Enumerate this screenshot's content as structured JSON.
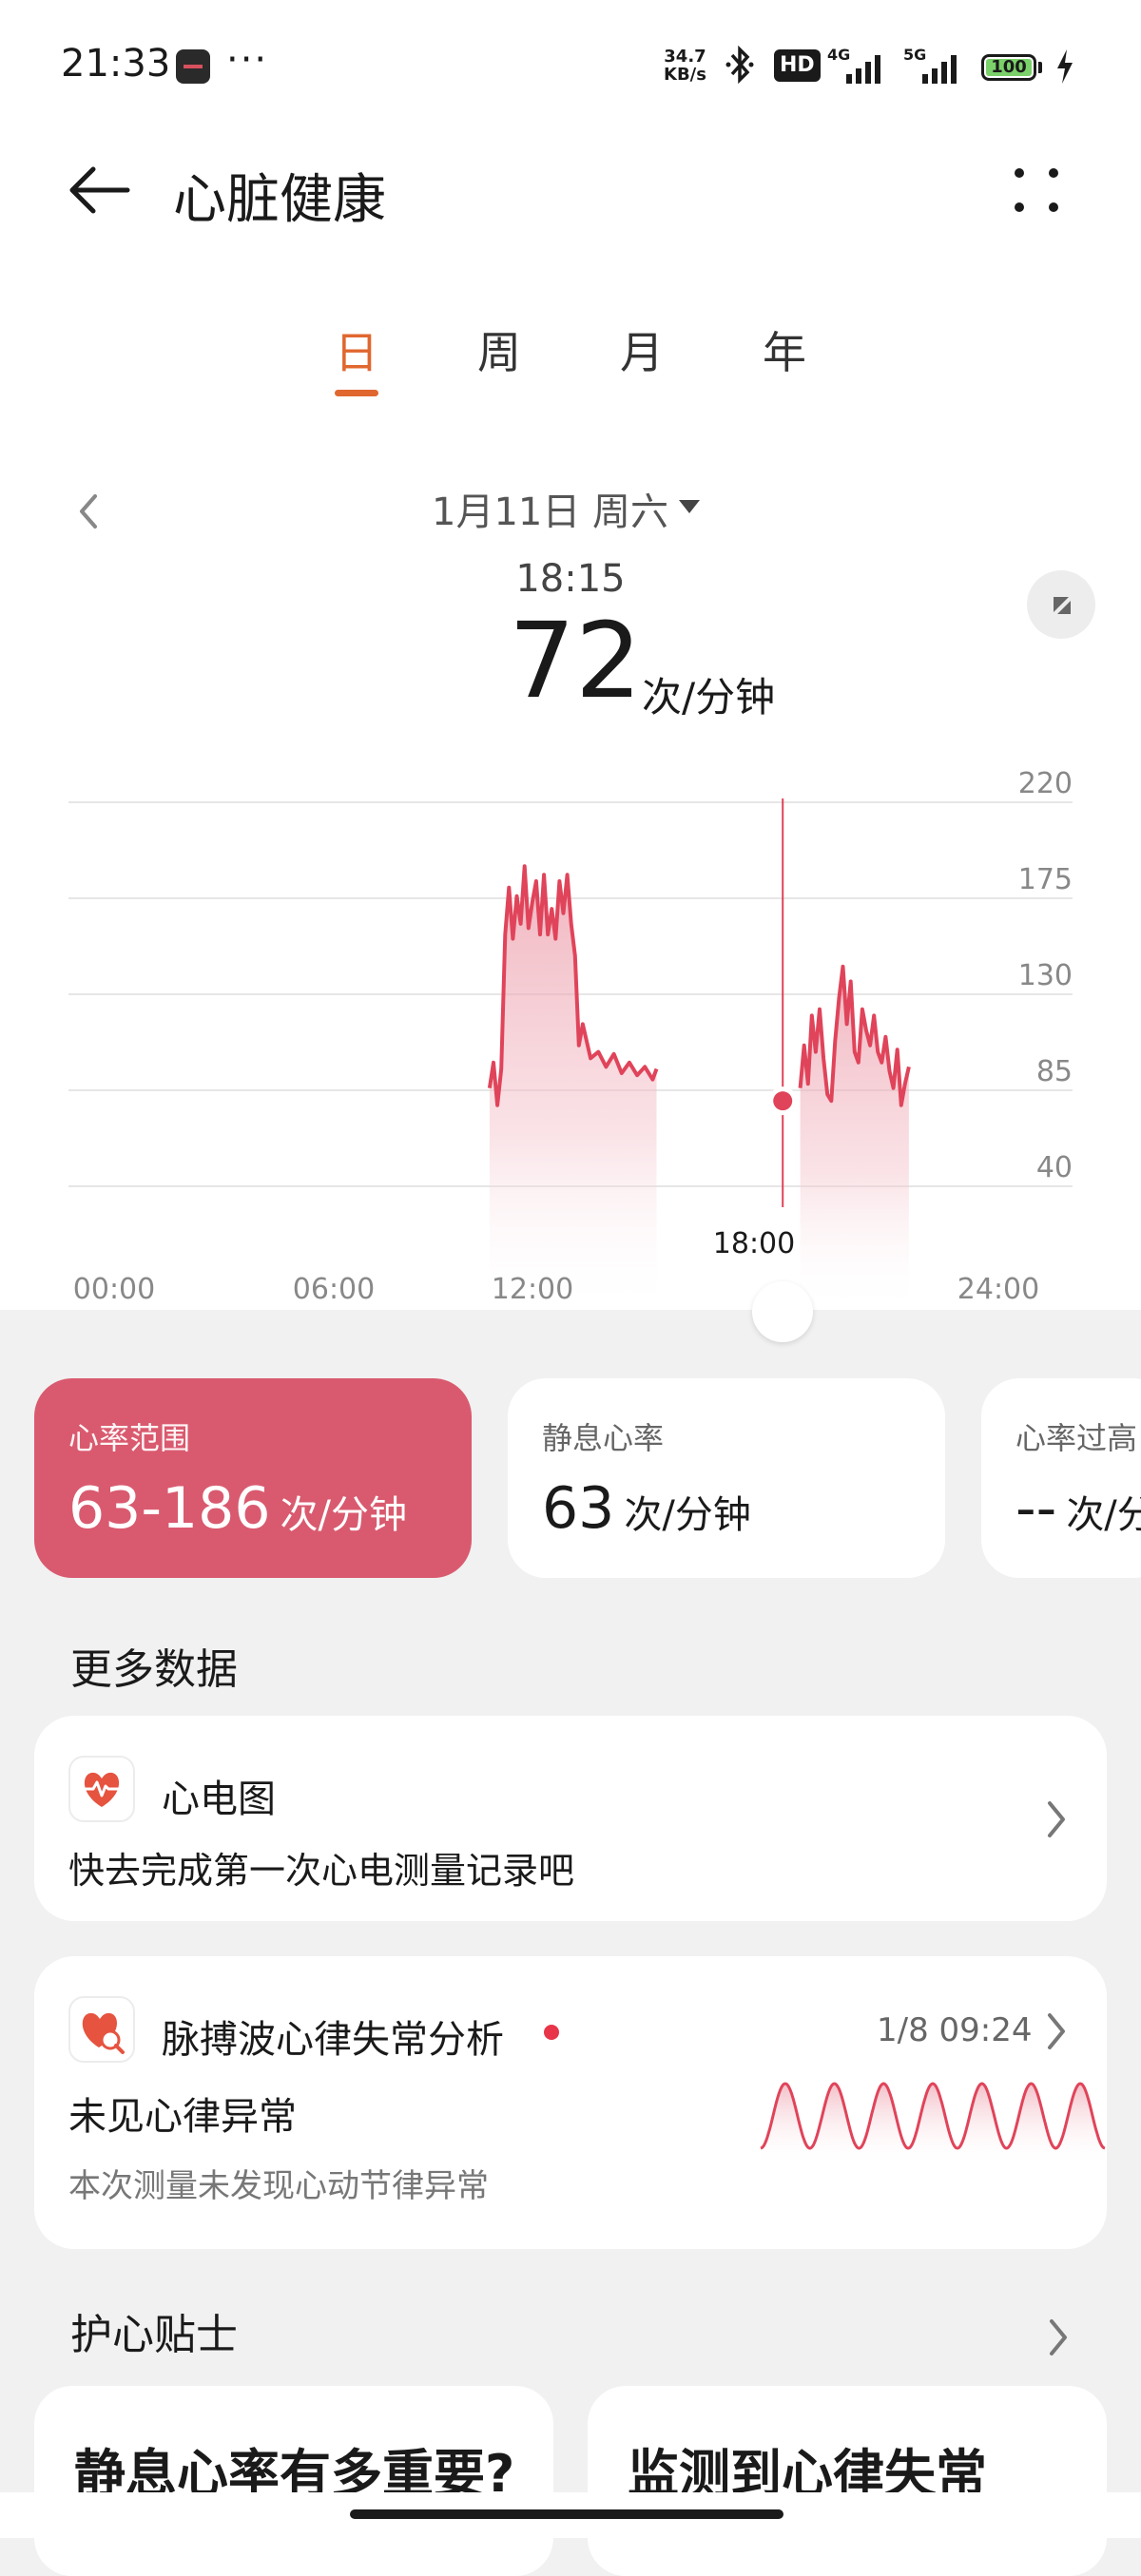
{
  "status_bar": {
    "time": "21:33",
    "more": "···",
    "net_speed_value": "34.7",
    "net_speed_unit": "KB/s",
    "hd_label": "HD",
    "net1": "4G",
    "net2": "5G",
    "battery": "100",
    "icons": [
      "app-icon",
      "bluetooth-icon",
      "signal-icon",
      "battery-icon",
      "charging-icon"
    ]
  },
  "header": {
    "title": "心脏健康",
    "back_icon": "arrow-left-icon",
    "more_icon": "more-dots-icon"
  },
  "tabs": [
    {
      "label": "日",
      "active": true
    },
    {
      "label": "周",
      "active": false
    },
    {
      "label": "月",
      "active": false
    },
    {
      "label": "年",
      "active": false
    }
  ],
  "date_nav": {
    "label": "1月11日 周六"
  },
  "selection": {
    "time": "18:15",
    "value": "72",
    "unit": "次/分钟"
  },
  "chart_data": {
    "type": "line",
    "x_axis_ticks": [
      "00:00",
      "06:00",
      "12:00",
      "18:00",
      "24:00"
    ],
    "y_axis_ticks": [
      220,
      175,
      130,
      85,
      40
    ],
    "xlim": [
      0,
      24
    ],
    "ylim": [
      40,
      220
    ],
    "grid": true,
    "y_axis_position": "right",
    "selected_point": {
      "x": 18.25,
      "y": 72
    },
    "segments": [
      {
        "x": [
          10.7,
          10.8,
          10.9,
          11.0,
          11.1,
          11.2,
          11.3,
          11.4,
          11.5,
          11.6,
          11.7,
          11.8,
          11.9,
          12.0,
          12.1,
          12.2,
          12.3,
          12.4,
          12.5,
          12.6,
          12.7,
          12.8,
          12.9,
          13.0,
          13.1,
          13.3,
          13.5,
          13.7,
          13.9,
          14.1,
          14.3,
          14.5,
          14.7,
          14.9,
          15.0
        ],
        "y": [
          78,
          90,
          70,
          87,
          150,
          172,
          148,
          168,
          155,
          182,
          153,
          165,
          175,
          150,
          178,
          150,
          162,
          148,
          175,
          160,
          178,
          155,
          140,
          98,
          108,
          92,
          95,
          88,
          94,
          85,
          90,
          84,
          88,
          82,
          87
        ]
      },
      {
        "x": [
          18.7,
          18.8,
          18.9,
          19.0,
          19.1,
          19.2,
          19.3,
          19.4,
          19.5,
          19.6,
          19.7,
          19.8,
          19.9,
          20.0,
          20.1,
          20.2,
          20.3,
          20.4,
          20.5,
          20.6,
          20.7,
          20.8,
          20.9,
          21.0,
          21.1,
          21.2,
          21.3,
          21.4,
          21.5
        ],
        "y": [
          78,
          98,
          80,
          112,
          95,
          115,
          92,
          75,
          72,
          100,
          120,
          135,
          108,
          128,
          95,
          90,
          115,
          105,
          98,
          112,
          95,
          90,
          102,
          86,
          78,
          96,
          70,
          80,
          88
        ]
      }
    ]
  },
  "metrics": [
    {
      "title": "心率范围",
      "value": "63-186",
      "unit": "次/分钟"
    },
    {
      "title": "静息心率",
      "value": "63",
      "unit": "次/分钟"
    },
    {
      "title": "心率过高",
      "value": "--",
      "unit": "次/分钟"
    }
  ],
  "more_data": {
    "title": "更多数据",
    "ecg": {
      "title": "心电图",
      "desc": "快去完成第一次心电测量记录吧",
      "icon": "heart-ecg-icon"
    },
    "pulse": {
      "title": "脉搏波心律失常分析",
      "time": "1/8 09:24",
      "result": "未见心律异常",
      "desc": "本次测量未发现心动节律异常",
      "icon": "heart-search-icon"
    }
  },
  "tips": {
    "title": "护心贴士",
    "cards": [
      {
        "title": "静息心率有多重要?"
      },
      {
        "title": "监测到心律失常"
      }
    ]
  },
  "colors": {
    "accent_orange": "#e0672f",
    "heart_red": "#d95a6f",
    "line_red": "#e0445a"
  }
}
